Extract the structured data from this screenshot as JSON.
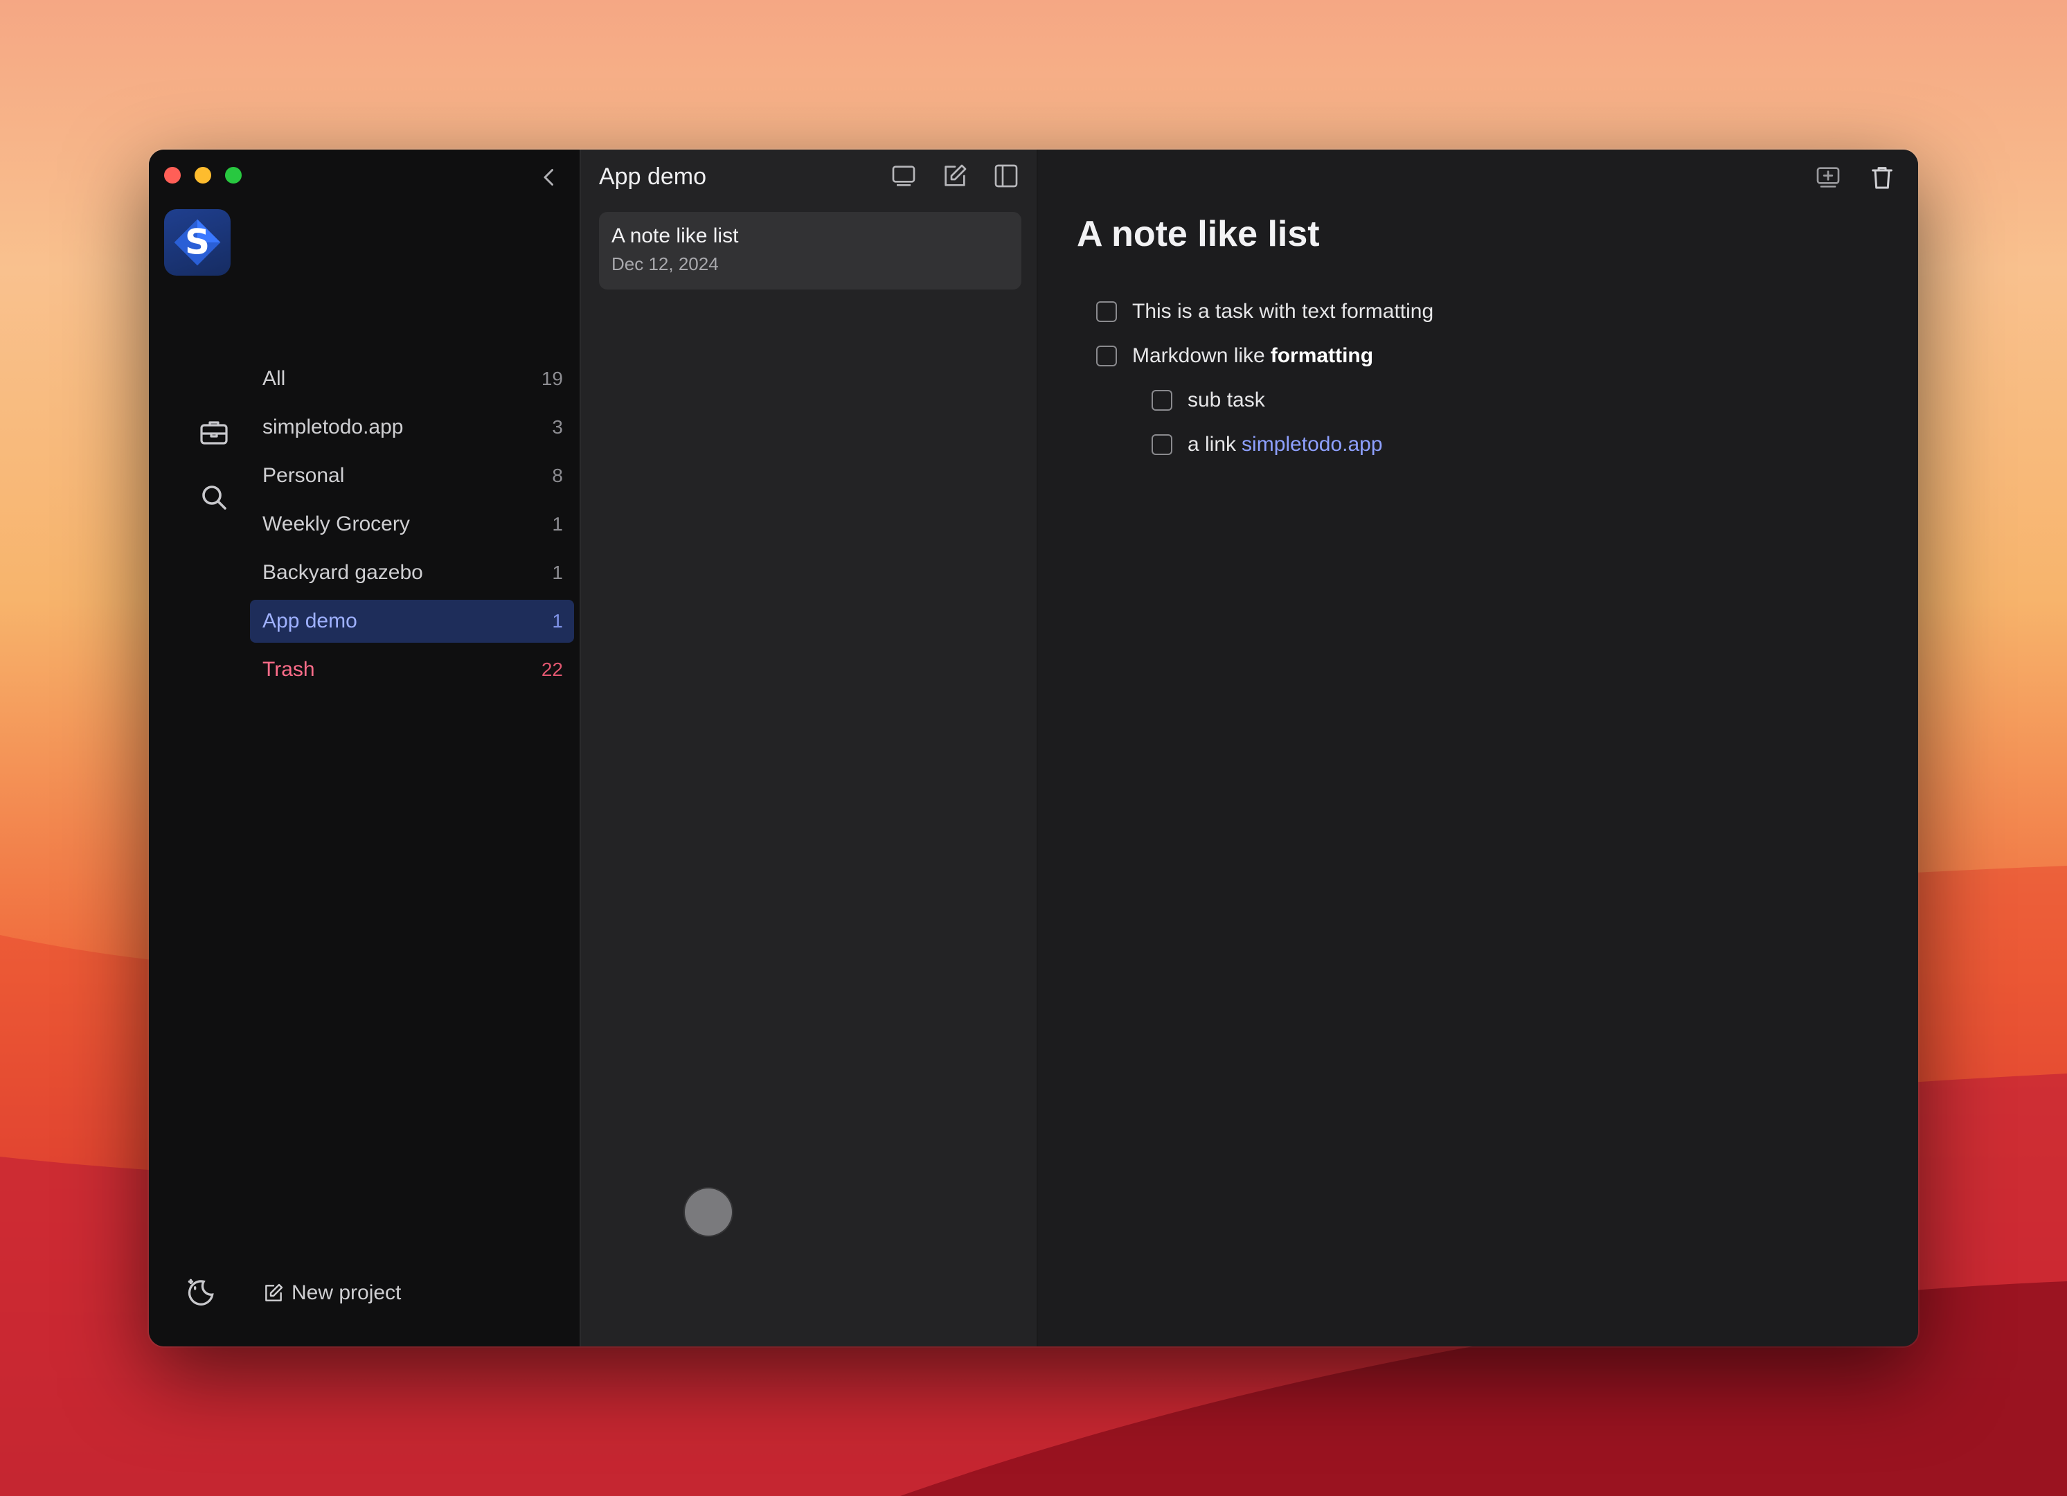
{
  "window": {
    "traffic_lights": [
      "close",
      "minimize",
      "zoom"
    ],
    "collapse_icon": "chevron-left-icon"
  },
  "sidebar": {
    "rail_icons": [
      "app-logo",
      "briefcase-icon",
      "search-icon"
    ],
    "projects": [
      {
        "label": "All",
        "count": "19"
      },
      {
        "label": "simpletodo.app",
        "count": "3"
      },
      {
        "label": "Personal",
        "count": "8"
      },
      {
        "label": "Weekly Grocery",
        "count": "1"
      },
      {
        "label": "Backyard gazebo",
        "count": "1"
      },
      {
        "label": "App demo",
        "count": "1",
        "selected": true
      },
      {
        "label": "Trash",
        "count": "22"
      }
    ],
    "new_project_label": "New project",
    "theme_icon": "theme-toggle-icon"
  },
  "notelist": {
    "title": "App demo",
    "toolbar_icons": [
      "preview-icon",
      "compose-icon",
      "sidebar-icon"
    ],
    "notes": [
      {
        "title": "A note like list",
        "date": "Dec 12, 2024"
      }
    ]
  },
  "editor": {
    "toolbar_icons": [
      "export-icon",
      "trash-icon"
    ],
    "heading": "A note like list",
    "tasks": [
      {
        "text": "This is a task with text formatting"
      },
      {
        "text": "Markdown like",
        "bold": "formatting"
      },
      {
        "text": "sub task"
      },
      {
        "text": "a link",
        "link": "simpletodo.app"
      }
    ]
  },
  "colors": {
    "accent": "#9fb1ff",
    "selected_bg": "#1e2d5a",
    "trash": "#ff6d8a",
    "link": "#8ea0ff"
  }
}
